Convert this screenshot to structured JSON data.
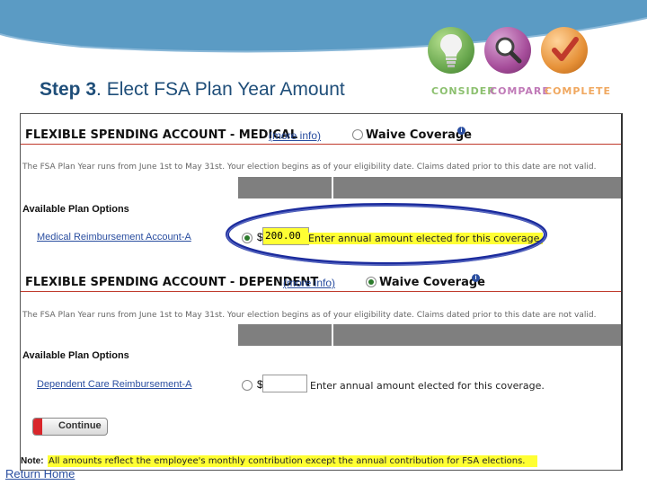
{
  "title": {
    "step": "Step 3",
    "rest": ". Elect FSA Plan Year Amount"
  },
  "steps": [
    {
      "label": "CONSIDER",
      "icon": "lightbulb-icon",
      "color": "#6aa84f"
    },
    {
      "label": "COMPARE",
      "icon": "magnifier-icon",
      "color": "#a64d9a"
    },
    {
      "label": "COMPLETE",
      "icon": "checkmark-icon",
      "color": "#e69138"
    }
  ],
  "medical": {
    "title": "FLEXIBLE SPENDING ACCOUNT - MEDICAL",
    "more_info": "(more info)",
    "waive": "Waive Coverage",
    "notice": "The FSA Plan Year runs from June 1st to May 31st. Your election begins as of your eligibility date. Claims dated prior to this date are not valid.",
    "options_label": "Available Plan Options",
    "plan_name": "Medical Reimbursement Account-A",
    "currency": "$",
    "amount": "200.00",
    "hint": "Enter annual amount elected for this coverage."
  },
  "dependent": {
    "title": "FLEXIBLE SPENDING ACCOUNT - DEPENDENT",
    "more_info": "(more info)",
    "waive": "Waive Coverage",
    "notice": "The FSA Plan Year runs from June 1st to May 31st. Your election begins as of your eligibility date. Claims dated prior to this date are not valid.",
    "options_label": "Available Plan Options",
    "plan_name": "Dependent Care Reimbursement-A",
    "currency": "$",
    "amount": "",
    "hint": "Enter annual amount elected for this coverage."
  },
  "continue_label": "Continue",
  "note_prefix": "Note:",
  "note_text": "All amounts reflect the employee's monthly contribution except the annual contribution for FSA elections.",
  "return_home": "Return Home",
  "colors": {
    "accent": "#4a90c2",
    "highlight_ring": "#1a2a9c",
    "note_bg": "#ffff33"
  }
}
